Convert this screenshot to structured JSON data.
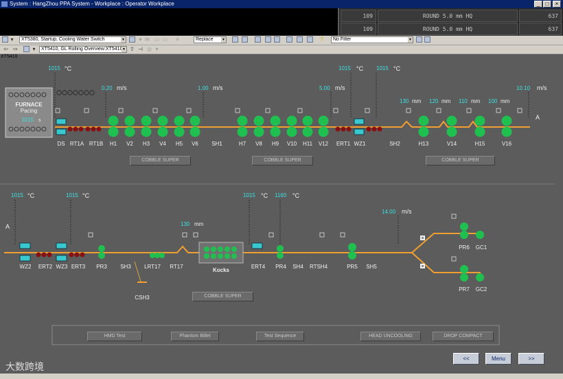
{
  "window": {
    "title": "System : HangZhou PPA System - Workplace : Operator Workplace",
    "min_label": "_",
    "max_label": "□",
    "close_label": "×"
  },
  "status": {
    "rows": [
      {
        "left": "109",
        "center": "ROUND 5.0 mm HQ",
        "right": "637"
      },
      {
        "left": "109",
        "center": "ROUND 5.0 mm HQ",
        "right": "637"
      }
    ]
  },
  "toolbar1": {
    "view_select": "XT5380, Startup, Cooling Water Switch",
    "mode_select": "Replace",
    "filter_select": "No Filter"
  },
  "toolbar2": {
    "view_select": "XT5410, GL Rolling Overview:XT541C"
  },
  "sublabel": "XT5410",
  "furnace": {
    "label1": "FURNACE",
    "label2": "Pacing",
    "value": "1015",
    "unit": "s"
  },
  "top": {
    "temps": [
      {
        "value": "1015",
        "unit": "°C"
      },
      {
        "value": "1015",
        "unit": "°C"
      },
      {
        "value": "1015",
        "unit": "°C"
      }
    ],
    "speeds": [
      {
        "value": "0.20",
        "unit": "m/s"
      },
      {
        "value": "1.00",
        "unit": "m/s"
      },
      {
        "value": "5.00",
        "unit": "m/s"
      },
      {
        "value": "10.10",
        "unit": "m/s"
      }
    ],
    "dims": [
      {
        "value": "130",
        "unit": "mm"
      },
      {
        "value": "120",
        "unit": "mm"
      },
      {
        "value": "110",
        "unit": "mm"
      },
      {
        "value": "100",
        "unit": "mm"
      }
    ],
    "labels": [
      "DS",
      "RT1A",
      "RT1B",
      "H1",
      "V2",
      "H3",
      "V4",
      "H5",
      "V6",
      "SH1",
      "H7",
      "V8",
      "H9",
      "V10",
      "H11",
      "V12",
      "ERT1",
      "WZ1",
      "SH2",
      "H13",
      "V14",
      "H15",
      "V16"
    ],
    "end_label": "A",
    "buttons": [
      "COBBLE SUPER",
      "COBBLE SUPER",
      "COBBLE SUPER"
    ]
  },
  "bottom": {
    "start_label": "A",
    "temps": [
      {
        "value": "1015",
        "unit": "°C"
      },
      {
        "value": "1015",
        "unit": "°C"
      },
      {
        "value": "1015",
        "unit": "°C"
      },
      {
        "value": "1160",
        "unit": "°C"
      }
    ],
    "dims": [
      {
        "value": "130",
        "unit": "mm"
      }
    ],
    "speeds": [
      {
        "value": "14.00",
        "unit": "m/s"
      }
    ],
    "labels": [
      "WZ2",
      "ERT2",
      "WZ3",
      "ERT3",
      "PR3",
      "SH3",
      "LRT17",
      "RT17",
      "ERT4",
      "PR4",
      "SH4",
      "RTSH4",
      "PR5",
      "SH5",
      "PR6",
      "GC1",
      "PR7",
      "GC2"
    ],
    "kocks_label": "Kocks",
    "csh3_label": "CSH3",
    "button": "COBBLE SUPER"
  },
  "actions": [
    "HMD Test",
    "Phantom Billet",
    "Test Sequence",
    "HEAD UNCOOLING",
    "DROP COMPACT"
  ],
  "nav": {
    "prev": "<<",
    "menu": "Menu",
    "next": ">>"
  },
  "watermark": "大数跨境"
}
